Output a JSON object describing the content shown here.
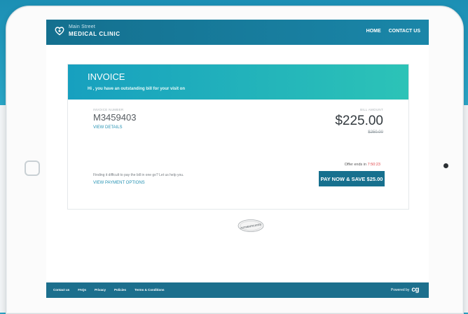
{
  "nav": {
    "logo_line1": "Main Street",
    "logo_line2": "MEDICAL CLINIC",
    "links": [
      "HOME",
      "CONTACT US"
    ]
  },
  "invoice": {
    "title": "INVOICE",
    "subtitle": "Hi , you have an outstanding bill for your visit on",
    "number_label": "INVOICE NUMBER",
    "number": "M3459403",
    "view_details": "VIEW DETAILS",
    "bill_label": "BILL AMOUNT",
    "bill_amount": "$225.00",
    "bill_original": "$250.00",
    "offer_prefix": "Offer ends in ",
    "offer_time": "7:50:23",
    "pay_button": "PAY NOW & SAVE $25.00",
    "help_text": "Finding it difficult to pay the bill in one go? Let us help you.",
    "view_payment_options": "VIEW PAYMENT OPTIONS"
  },
  "seal": {
    "text": "AUTHENTICATED"
  },
  "footer": {
    "links": [
      "Contact us",
      "FAQs",
      "Privacy",
      "Policies",
      "Terms & Conditions"
    ],
    "powered_by": "Powered by"
  },
  "colors": {
    "navbar": "#14708f",
    "header_gradient_start": "#17a0bf",
    "header_gradient_end": "#2cc3b7",
    "pay_button": "#17708e",
    "link": "#2592b3",
    "countdown": "#e0484c"
  },
  "icons": {
    "logo": "heart-plus-icon",
    "home": "home-button-icon",
    "camera": "camera-icon",
    "seal": "seal-icon",
    "footer_logo": "cg-logo-icon"
  }
}
